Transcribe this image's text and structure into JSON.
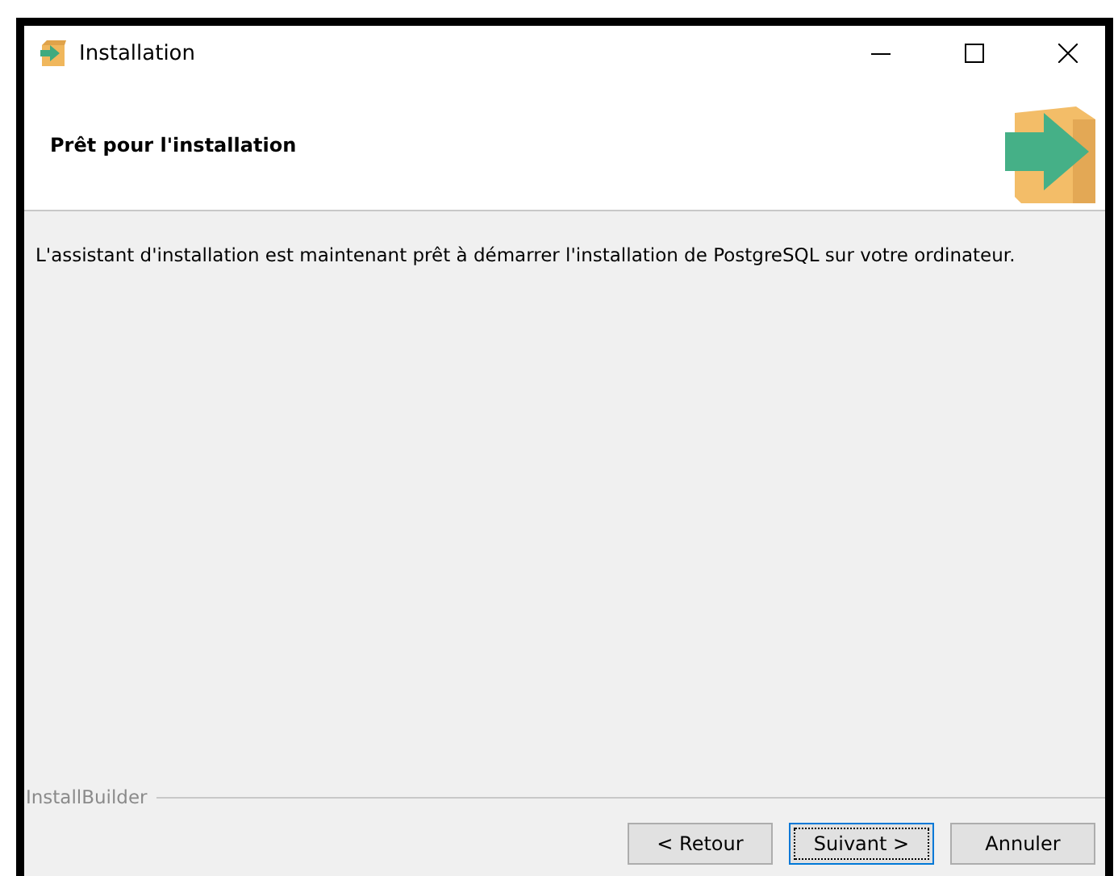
{
  "window": {
    "title": "Installation"
  },
  "header": {
    "title": "Prêt pour l'installation"
  },
  "message": "L'assistant d'installation est maintenant prêt à démarrer l'installation de PostgreSQL sur votre ordinateur.",
  "footer": {
    "brand": "InstallBuilder"
  },
  "buttons": [
    {
      "label": "< Retour",
      "focused": false
    },
    {
      "label": "Suivant >",
      "focused": true
    },
    {
      "label": "Annuler",
      "focused": false
    }
  ]
}
